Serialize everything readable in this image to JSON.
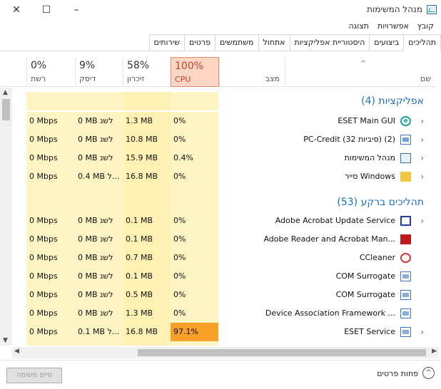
{
  "window": {
    "title": "מנהל המשימות",
    "minimize": "–",
    "maximize": "☐",
    "close": "✕"
  },
  "menu": [
    "קובץ",
    "אפשרויות",
    "תצוגה"
  ],
  "tabs": [
    "תהליכים",
    "ביצועים",
    "היסטוריית אפליקציות",
    "אתחול",
    "משתמשים",
    "פרטים",
    "שירותים"
  ],
  "header": {
    "name": "שם",
    "status": "מצב",
    "cpu_pct": "100%",
    "cpu_label": "CPU",
    "mem_pct": "58%",
    "mem_label": "זיכרון",
    "disk_pct": "9%",
    "disk_label": "דיסק",
    "net_pct": "0%",
    "net_label": "רשת",
    "sort_indicator": "^"
  },
  "groups": {
    "apps": "אפליקציות (4)",
    "background": "תהליכים ברקע (53)"
  },
  "apps": [
    {
      "name": "ESET Main GUI",
      "icon": "eset-icon",
      "expand": "›",
      "cpu": "0%",
      "mem": "1.3 MB",
      "disk": "0 MB לשנ",
      "net": "0 Mbps"
    },
    {
      "name": "PC-Credit (32 סיביות) (2)",
      "icon": "window-icon",
      "expand": "›",
      "cpu": "0%",
      "mem": "10.8 MB",
      "disk": "0 MB לשנ",
      "net": "0 Mbps"
    },
    {
      "name": "מנהל המשימות",
      "icon": "task-manager-icon",
      "expand": "›",
      "cpu": "0.4%",
      "mem": "15.9 MB",
      "disk": "0 MB לשנ",
      "net": "0 Mbps"
    },
    {
      "name": "Windows סייר",
      "icon": "folder-icon",
      "expand": "›",
      "cpu": "0%",
      "mem": "16.8 MB",
      "disk": "0.4 MB ל...",
      "net": "0 Mbps"
    }
  ],
  "background": [
    {
      "name": "Adobe Acrobat Update Service",
      "icon": "acrobat-update-icon",
      "expand": "›",
      "cpu": "0%",
      "mem": "0.1 MB",
      "disk": "0 MB לשנ",
      "net": "0 Mbps"
    },
    {
      "name": "Adobe Reader and Acrobat Man...",
      "icon": "acrobat-icon",
      "expand": "",
      "cpu": "0%",
      "mem": "0.1 MB",
      "disk": "0 MB לשנ",
      "net": "0 Mbps"
    },
    {
      "name": "CCleaner",
      "icon": "ccleaner-icon",
      "expand": "",
      "cpu": "0%",
      "mem": "0.7 MB",
      "disk": "0 MB לשנ",
      "net": "0 Mbps"
    },
    {
      "name": "COM Surrogate",
      "icon": "com-surrogate-icon",
      "expand": "",
      "cpu": "0%",
      "mem": "0.1 MB",
      "disk": "0 MB לשנ",
      "net": "0 Mbps"
    },
    {
      "name": "COM Surrogate",
      "icon": "com-surrogate-icon",
      "expand": "",
      "cpu": "0%",
      "mem": "0.5 MB",
      "disk": "0 MB לשנ",
      "net": "0 Mbps"
    },
    {
      "name": "Device Association Framework ...",
      "icon": "device-association-icon",
      "expand": "",
      "cpu": "0%",
      "mem": "1.3 MB",
      "disk": "0 MB לשנ",
      "net": "0 Mbps"
    },
    {
      "name": "ESET Service",
      "icon": "eset-service-icon",
      "expand": "›",
      "cpu": "97.1%",
      "mem": "16.8 MB",
      "disk": "0.1 MB ל...",
      "net": "0 Mbps",
      "hot": true
    }
  ],
  "footer": {
    "end_task": "סיים משימה",
    "fewer_details": "פחות פרטים",
    "fewer_icon": "^"
  },
  "colors": {
    "usage_cell": "#fff4c4",
    "cpu_header": "#fdd5c5",
    "hot_cpu": "#f8a028",
    "group_text": "#1e6fb8"
  }
}
